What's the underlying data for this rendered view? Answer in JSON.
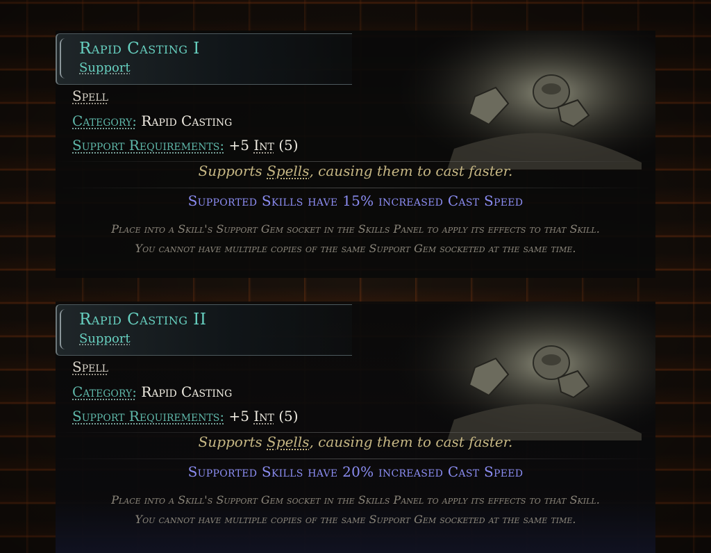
{
  "tooltips": [
    {
      "name": "Rapid Casting I",
      "type": "Support",
      "tag": "Spell",
      "category_label": "Category:",
      "category_value": "Rapid Casting",
      "requirements_label": "Support Requirements:",
      "requirements_value_prefix": "+5",
      "requirements_value_int": "Int",
      "requirements_value_suffix": "(5)",
      "description_pre": "Supports",
      "description_keyword": "Spells",
      "description_post": ", causing them to cast faster.",
      "modifier": "Supported Skills have 15% increased Cast Speed",
      "flavor": "Place into a Skill's Support Gem socket in the Skills Panel to apply its effects to that Skill. You cannot have multiple copies of the same Support Gem socketed at the same time."
    },
    {
      "name": "Rapid Casting II",
      "type": "Support",
      "tag": "Spell",
      "category_label": "Category:",
      "category_value": "Rapid Casting",
      "requirements_label": "Support Requirements:",
      "requirements_value_prefix": "+5",
      "requirements_value_int": "Int",
      "requirements_value_suffix": "(5)",
      "description_pre": "Supports",
      "description_keyword": "Spells",
      "description_post": ", causing them to cast faster.",
      "modifier": "Supported Skills have 20% increased Cast Speed",
      "flavor": "Place into a Skill's Support Gem socket in the Skills Panel to apply its effects to that Skill. You cannot have multiple copies of the same Support Gem socketed at the same time."
    }
  ],
  "colors": {
    "gem_name": "#67d0c0",
    "label": "#5fb8aa",
    "value": "#f0ece2",
    "description": "#c6b784",
    "modifier": "#8b8df3",
    "flavor": "#8c877c"
  },
  "icons": {
    "art": "gem-art-icon"
  }
}
